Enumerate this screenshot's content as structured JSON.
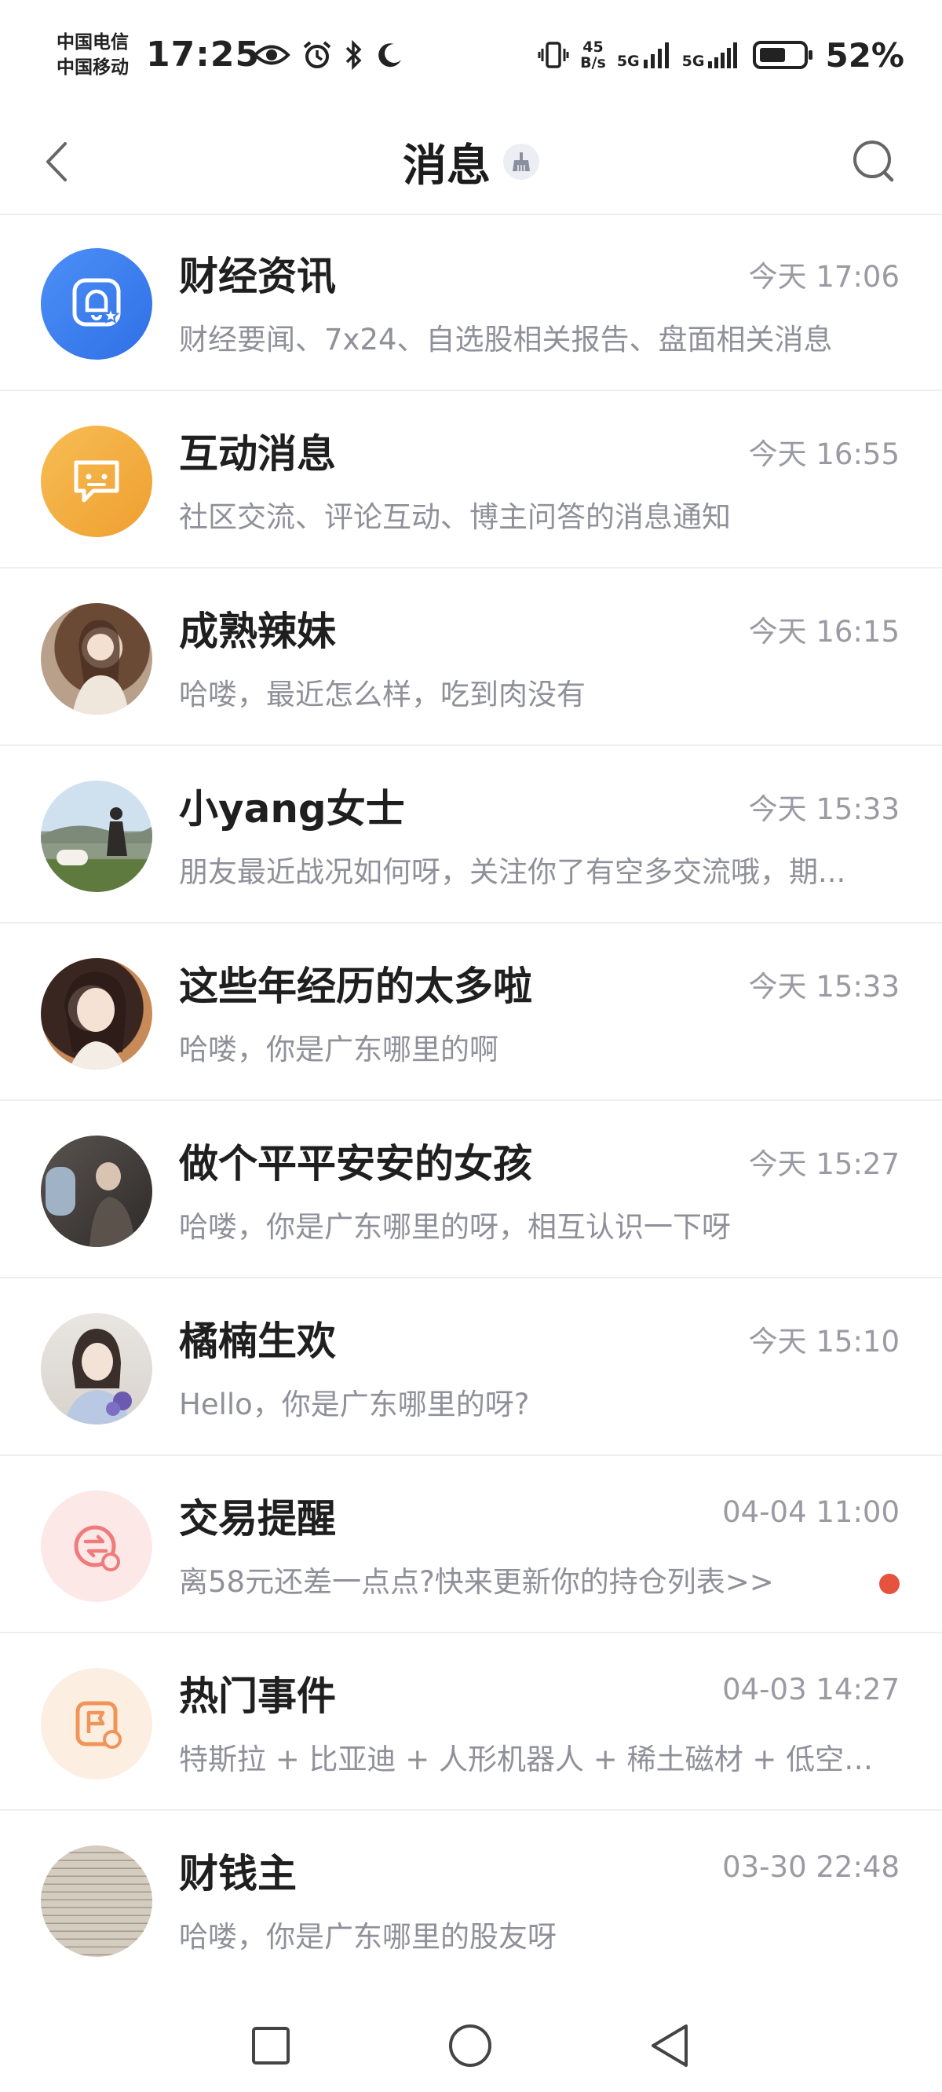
{
  "status_bar": {
    "carrier_1": "中国电信",
    "carrier_2": "中国移动",
    "time": "17:25",
    "net_speed_value": "45",
    "net_speed_unit": "B/s",
    "signal_1_label": "5G",
    "signal_2_label": "5G",
    "battery": "52%",
    "icons": [
      "eye-icon",
      "alarm-icon",
      "bluetooth-icon",
      "moon-icon",
      "vibrate-icon",
      "signal-icon",
      "battery-icon"
    ]
  },
  "header": {
    "title": "消息",
    "icons": [
      "back-chevron-icon",
      "broom-icon",
      "search-icon"
    ]
  },
  "messages": [
    {
      "name": "财经资讯",
      "time": "今天 17:06",
      "preview": "财经要闻、7x24、自选股相关报告、盘面相关消息",
      "avatar": "bell-star-icon",
      "avatar_color": "#3d7ff0"
    },
    {
      "name": "互动消息",
      "time": "今天 16:55",
      "preview": "社区交流、评论互动、博主问答的消息通知",
      "avatar": "chat-bubble-icon",
      "avatar_color": "#f3ae40"
    },
    {
      "name": "成熟辣妹",
      "time": "今天 16:15",
      "preview": "哈喽，最近怎么样，吃到肉没有",
      "avatar": "user-photo"
    },
    {
      "name": "小yang女士",
      "time": "今天 15:33",
      "preview": "朋友最近战况如何呀，关注你了有空多交流哦，期...",
      "avatar": "user-photo"
    },
    {
      "name": "这些年经历的太多啦",
      "time": "今天 15:33",
      "preview": "哈喽，你是广东哪里的啊",
      "avatar": "user-photo"
    },
    {
      "name": "做个平平安安的女孩",
      "time": "今天 15:27",
      "preview": "哈喽，你是广东哪里的呀，相互认识一下呀",
      "avatar": "user-photo"
    },
    {
      "name": "橘楠生欢",
      "time": "今天 15:10",
      "preview": "Hello，你是广东哪里的呀?",
      "avatar": "user-photo"
    },
    {
      "name": "交易提醒",
      "time": "04-04 11:00",
      "preview": "离58元还差一点点?快来更新你的持仓列表>>",
      "avatar": "trade-alert-icon",
      "avatar_color": "#fde8e8",
      "unread": true
    },
    {
      "name": "热门事件",
      "time": "04-03 14:27",
      "preview": "特斯拉 + 比亚迪 + 人形机器人 + 稀土磁材 + 低空经...",
      "avatar": "flag-event-icon",
      "avatar_color": "#fdeee2"
    },
    {
      "name": "财钱主",
      "time": "03-30 22:48",
      "preview": "哈喽，你是广东哪里的股友呀",
      "avatar": "user-photo"
    }
  ],
  "colors": {
    "accent_blue": "#3d7ff0",
    "accent_orange": "#f3ae40",
    "unread_dot": "#e5533e",
    "text_secondary": "#8f9099"
  },
  "nav_bar": {
    "icons": [
      "recents-square-icon",
      "home-circle-icon",
      "back-triangle-icon"
    ]
  }
}
